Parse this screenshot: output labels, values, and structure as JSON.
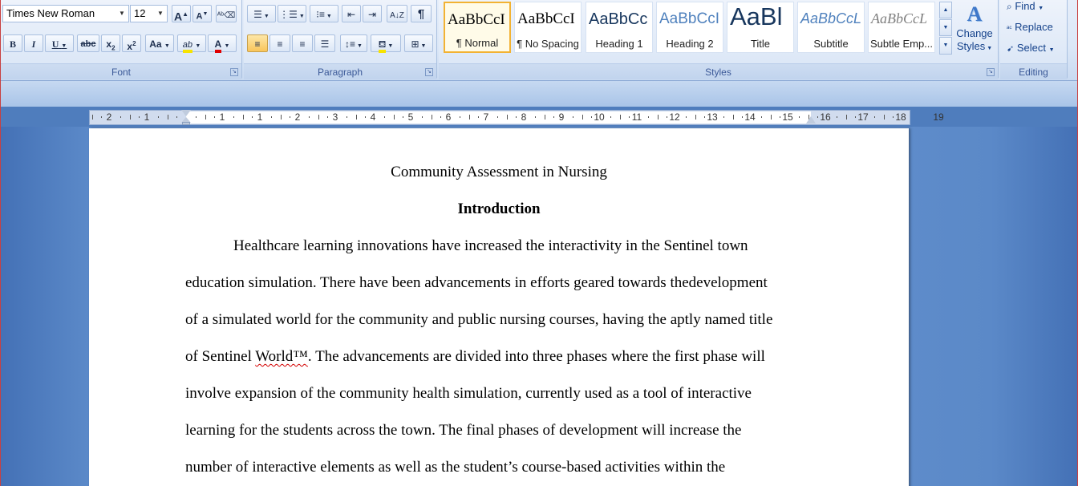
{
  "font_group": {
    "label": "Font",
    "font_name": "Times New Roman",
    "font_size": "12",
    "grow_font": "A",
    "shrink_font": "A",
    "bold": "B",
    "italic": "I",
    "underline": "U",
    "strikethrough": "abc",
    "subscript": "x",
    "subscript_mark": "2",
    "superscript": "x",
    "superscript_mark": "2",
    "change_case": "Aa",
    "highlight": "ab",
    "font_color": "A",
    "highlight_color": "#f7e300",
    "font_color_value": "#e00000"
  },
  "paragraph_group": {
    "label": "Paragraph",
    "show_marks": "¶"
  },
  "styles_group": {
    "label": "Styles",
    "items": [
      {
        "sample": "AaBbCcI",
        "name": "¶ Normal"
      },
      {
        "sample": "AaBbCcI",
        "name": "¶ No Spacing"
      },
      {
        "sample": "AaBbCc",
        "name": "Heading 1"
      },
      {
        "sample": "AaBbCcI",
        "name": "Heading 2"
      },
      {
        "sample": "AaBl",
        "name": "Title"
      },
      {
        "sample": "AaBbCcL",
        "name": "Subtitle"
      },
      {
        "sample": "AaBbCcL",
        "name": "Subtle Emp..."
      }
    ],
    "change_styles_line1": "Change",
    "change_styles_line2": "Styles"
  },
  "editing_group": {
    "label": "Editing",
    "find": "Find",
    "replace": "Replace",
    "select": "Select"
  },
  "ruler": {
    "numbers": [
      "2",
      "1",
      "1",
      "1",
      "2",
      "3",
      "4",
      "5",
      "6",
      "7",
      "8",
      "9",
      "10",
      "11",
      "12",
      "13",
      "14",
      "15",
      "16",
      "17",
      "18",
      "19"
    ]
  },
  "document": {
    "title": "Community Assessment in Nursing",
    "heading": "Introduction",
    "lines": [
      "Healthcare learning innovations have increased the interactivity in the Sentinel town",
      "education simulation. There have been advancements in efforts geared towards thedevelopment",
      "of a simulated world for the community and public nursing courses, having the aptly named title",
      "of Sentinel ",
      "World™",
      ". The advancements are divided into three phases where the first phase will",
      "involve expansion of the community health simulation, currently used as a tool of interactive",
      "learning for the students across the town. The final phases of development will increase the",
      "number of interactive elements as well as the student’s course-based activities within the"
    ]
  }
}
